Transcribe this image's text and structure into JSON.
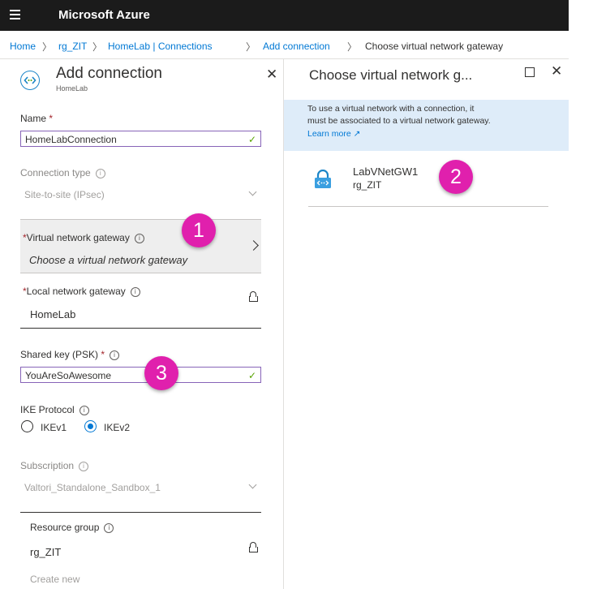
{
  "app": {
    "title": "Microsoft Azure"
  },
  "breadcrumb": [
    "Home",
    "rg_ZIT",
    "HomeLab | Connections",
    "Add connection",
    "Choose virtual network gateway"
  ],
  "left_blade": {
    "title": "Add connection",
    "subtitle": "HomeLab",
    "name": {
      "label": "Name",
      "value": "HomeLabConnection"
    },
    "connection_type": {
      "label": "Connection type",
      "value": "Site-to-site (IPsec)"
    },
    "virtual_network_gateway": {
      "label": "Virtual network gateway",
      "placeholder": "Choose a virtual network gateway"
    },
    "local_network_gateway": {
      "label": "Local network gateway",
      "value": "HomeLab"
    },
    "shared_key": {
      "label": "Shared key (PSK)",
      "value": "YouAreSoAwesome"
    },
    "ike_protocol": {
      "label": "IKE Protocol",
      "options": [
        "IKEv1",
        "IKEv2"
      ],
      "selected": "IKEv2"
    },
    "subscription": {
      "label": "Subscription",
      "value": "Valtori_Standalone_Sandbox_1"
    },
    "resource_group": {
      "label": "Resource group",
      "value": "rg_ZIT",
      "create_new": "Create new"
    }
  },
  "right_blade": {
    "title": "Choose virtual network g...",
    "info_line1": "To use a virtual network with a connection, it",
    "info_line2": "must be associated to a virtual network gateway.",
    "learn_more": "Learn more",
    "gateways": [
      {
        "name": "LabVNetGW1",
        "resource_group": "rg_ZIT"
      }
    ]
  },
  "annotations": {
    "badge1": "1",
    "badge2": "2",
    "badge3": "3"
  },
  "colors": {
    "topbar": "#1b1b1b",
    "link": "#0078d4",
    "accent_border": "#8764b8",
    "badge": "#e020ad",
    "banner": "#deecf9"
  }
}
